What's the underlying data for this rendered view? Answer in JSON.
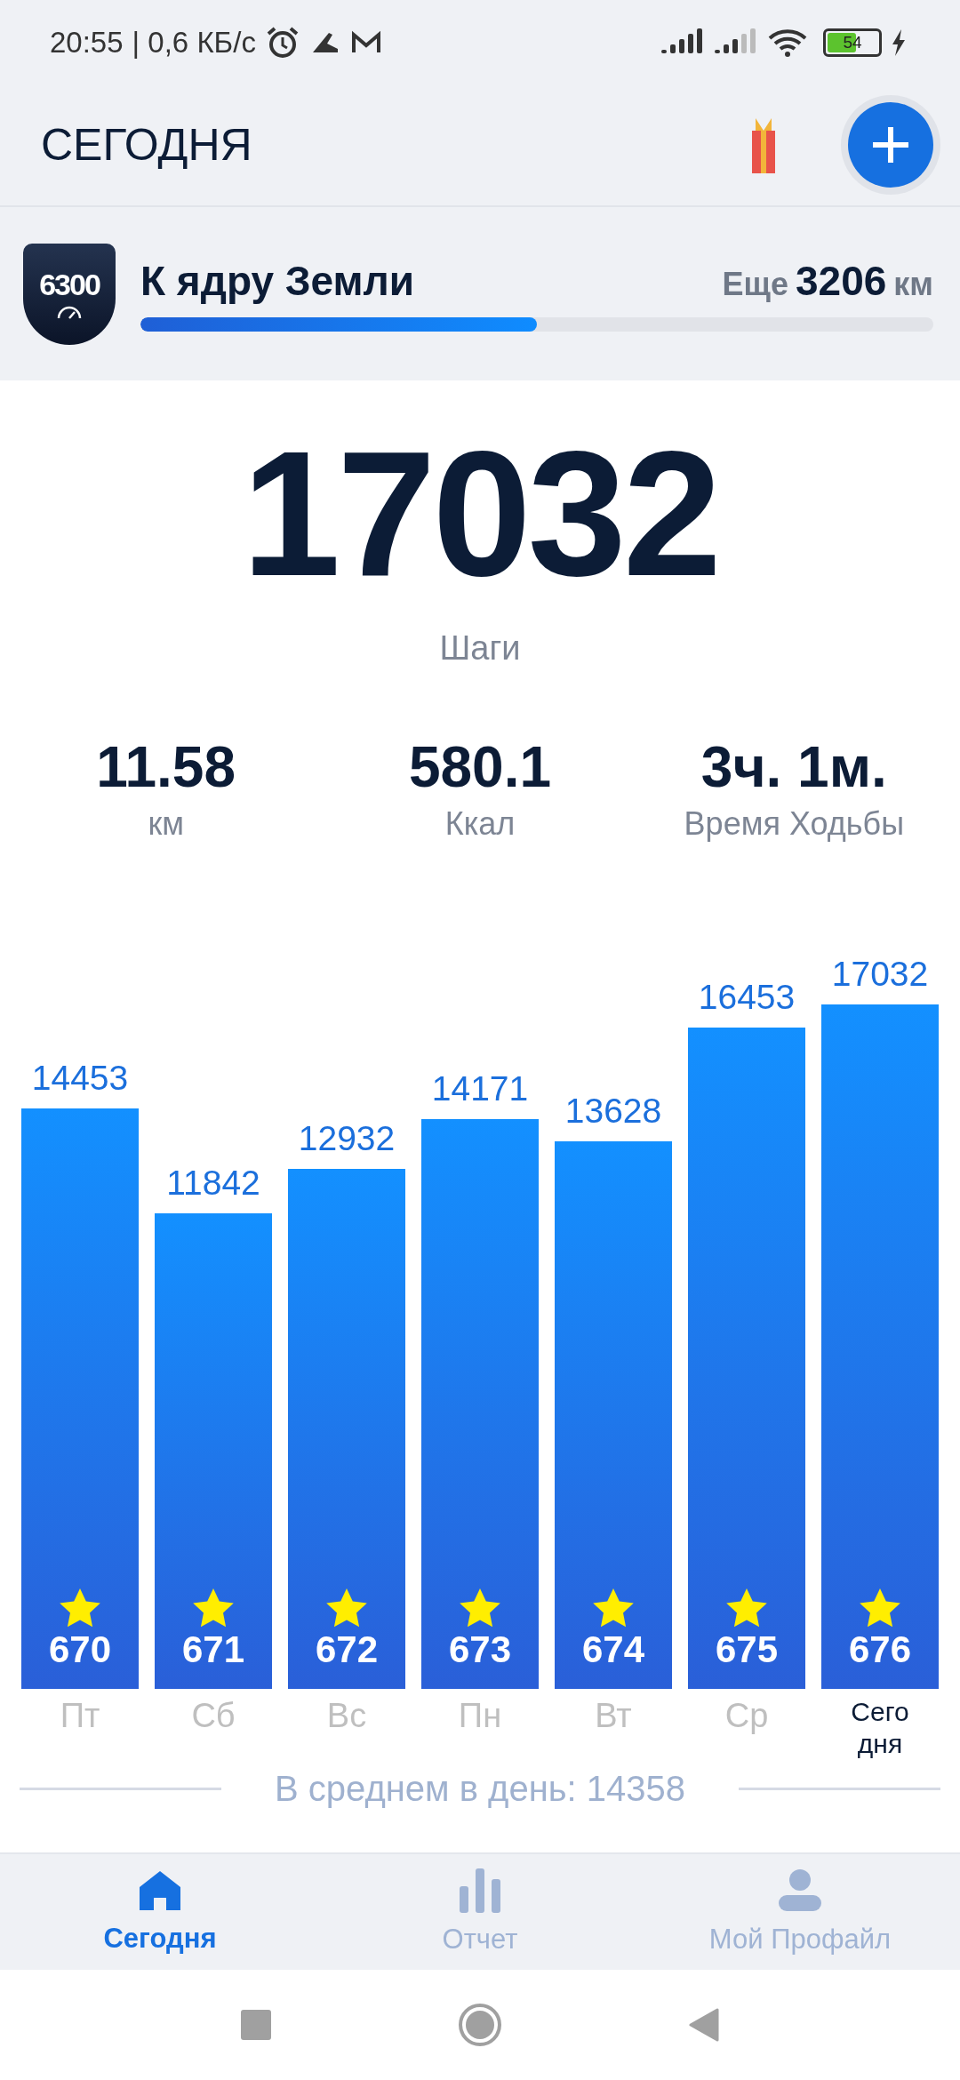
{
  "status_bar": {
    "time": "20:55",
    "speed": "| 0,6 КБ/с",
    "battery": "54"
  },
  "header": {
    "title": "СЕГОДНЯ"
  },
  "challenge": {
    "badge": "6300",
    "title": "К ядру Земли",
    "remaining_label": "Еще",
    "remaining_value": "3206",
    "remaining_unit": "км",
    "level": 0.5
  },
  "today": {
    "steps": "17032",
    "steps_label": "Шаги"
  },
  "stats": [
    {
      "value": "11.58",
      "label": "км"
    },
    {
      "value": "580.1",
      "label": "Ккал"
    },
    {
      "value": "3ч. 1м.",
      "label": "Время Ходьбы"
    }
  ],
  "chart": {
    "chart_data": {
      "type": "bar",
      "categories": [
        "Пт",
        "Сб",
        "Вс",
        "Пн",
        "Вт",
        "Ср",
        "Сегодня"
      ],
      "values": [
        14453,
        11842,
        12932,
        14171,
        13628,
        16453,
        17032
      ],
      "data_labels": true
    },
    "bar_badges": [
      {
        "count": "670",
        "selected": false
      },
      {
        "count": "671",
        "selected": false
      },
      {
        "count": "672",
        "selected": false
      },
      {
        "count": "673",
        "selected": false
      },
      {
        "count": "674",
        "selected": false
      },
      {
        "count": "675",
        "selected": false
      },
      {
        "count": "676",
        "selected": true
      }
    ],
    "average": "В среднем в день: 14358"
  },
  "bottom_nav": [
    {
      "label": "Сегодня",
      "kind": "home",
      "selected": true
    },
    {
      "label": "Отчет",
      "kind": "chart",
      "selected": false
    },
    {
      "label": "Мой Профайл",
      "kind": "profile",
      "selected": false
    }
  ]
}
